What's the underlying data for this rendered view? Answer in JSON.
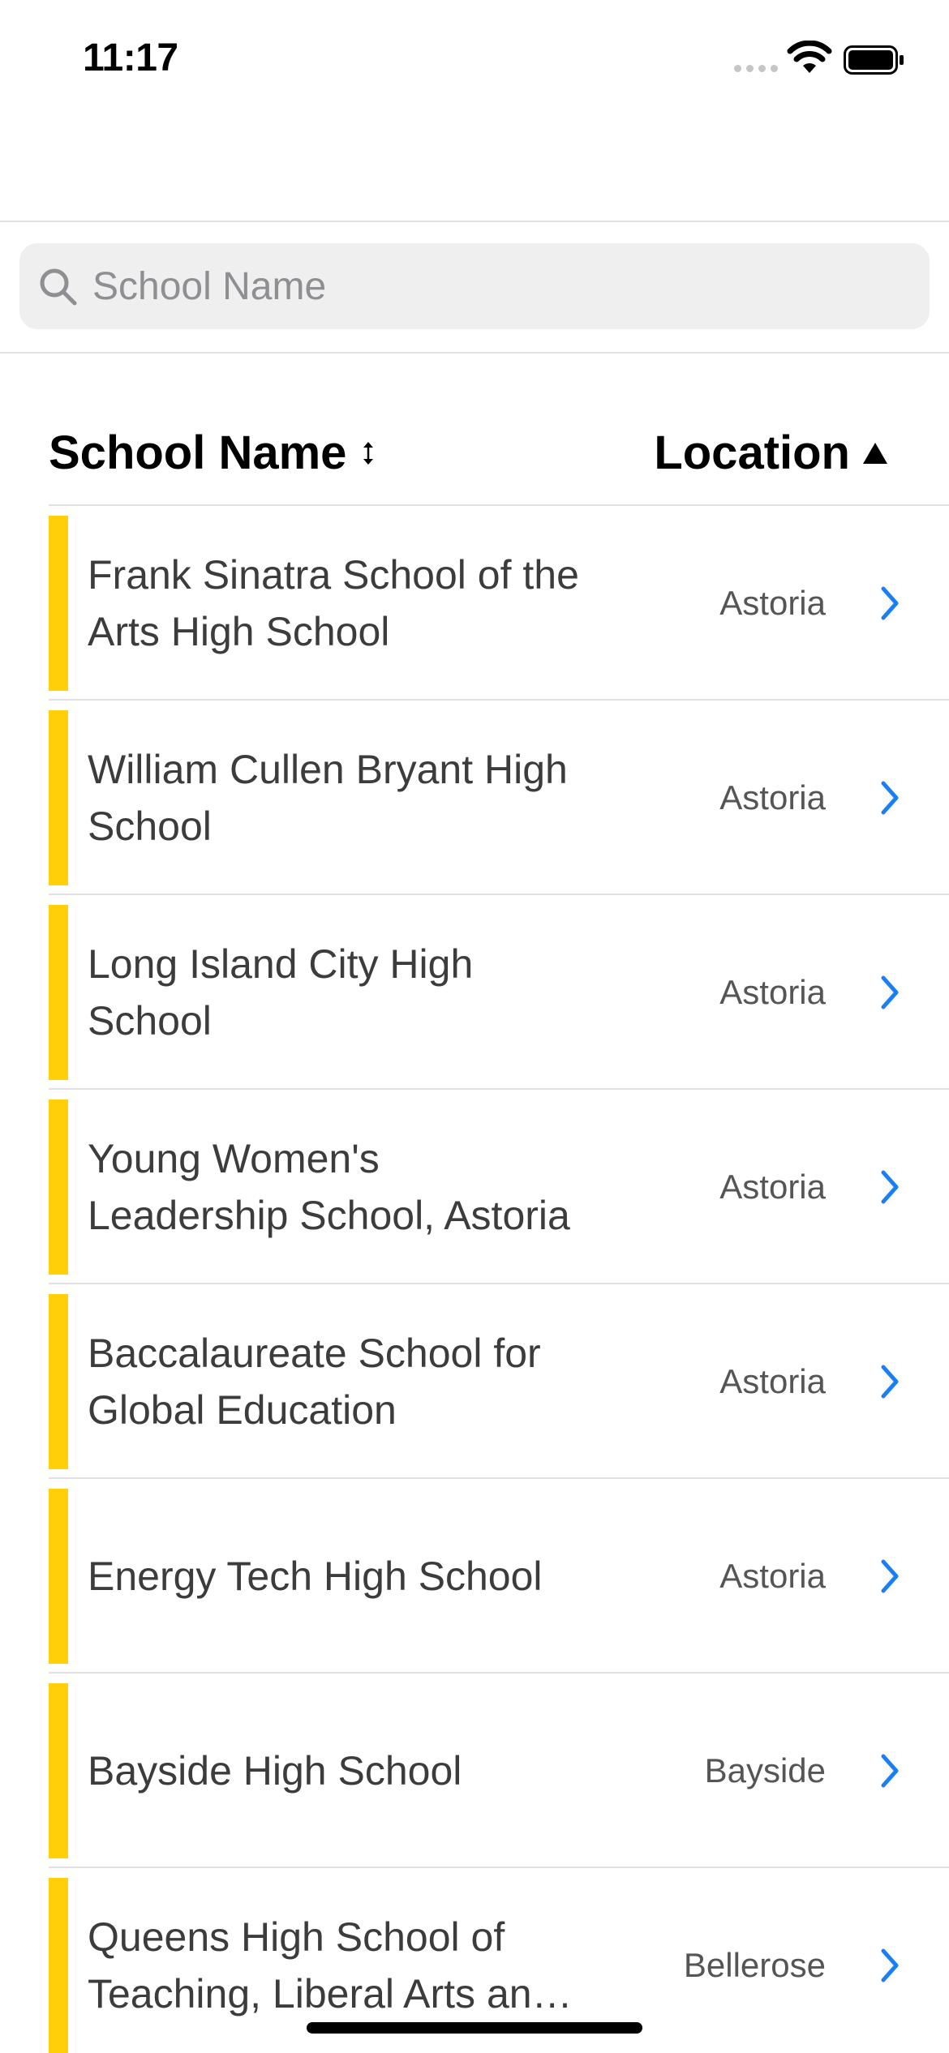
{
  "status_bar": {
    "time": "11:17"
  },
  "search": {
    "placeholder": "School Name",
    "value": ""
  },
  "columns": {
    "school_name": "School Name",
    "location": "Location",
    "location_sort": "ascending"
  },
  "colors": {
    "accent": "#ffd00a",
    "chevron": "#1a7ff0"
  },
  "schools": [
    {
      "name": "Frank Sinatra School of the Arts High School",
      "location": "Astoria"
    },
    {
      "name": "William Cullen Bryant High School",
      "location": "Astoria"
    },
    {
      "name": "Long Island City High School",
      "location": "Astoria"
    },
    {
      "name": "Young Women's Leadership School, Astoria",
      "location": "Astoria"
    },
    {
      "name": "Baccalaureate School for Global Education",
      "location": "Astoria"
    },
    {
      "name": "Energy Tech High School",
      "location": "Astoria"
    },
    {
      "name": "Bayside High School",
      "location": "Bayside"
    },
    {
      "name": "Queens High School of Teaching, Liberal Arts and the Sciences",
      "location": "Bellerose"
    }
  ]
}
